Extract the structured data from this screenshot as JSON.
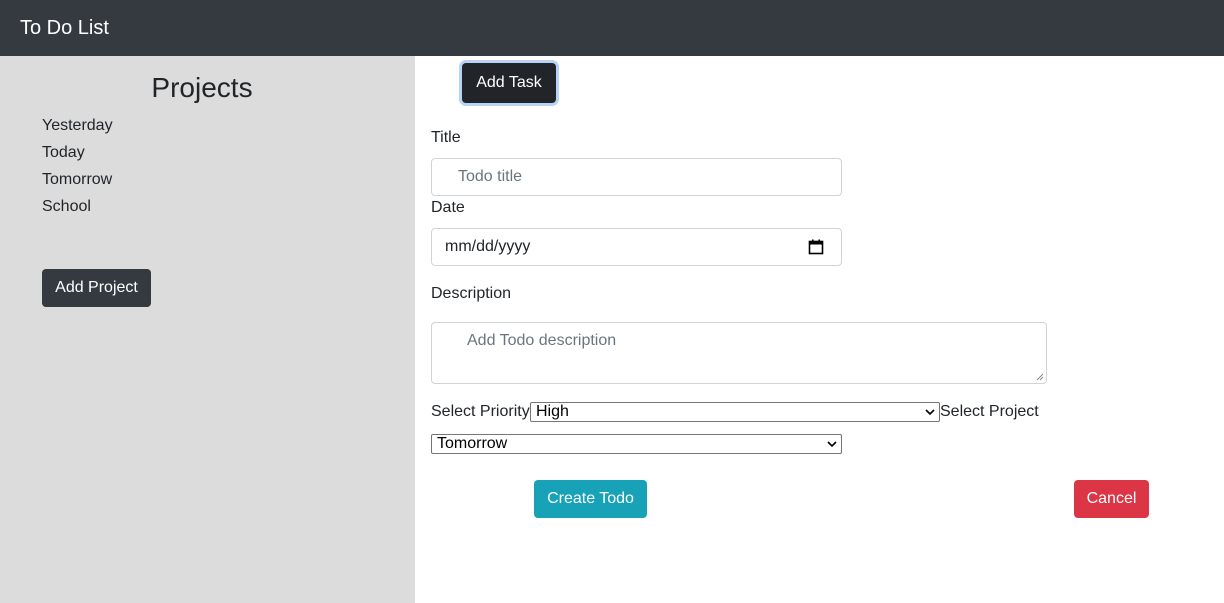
{
  "app": {
    "title": "To Do List"
  },
  "sidebar": {
    "heading": "Projects",
    "projects": [
      "Yesterday",
      "Today",
      "Tomorrow",
      "School"
    ],
    "add_project_label": "Add Project"
  },
  "main": {
    "add_task_label": "Add Task",
    "form": {
      "title_label": "Title",
      "title_placeholder": "Todo title",
      "date_label": "Date",
      "date_value": "mm/dd/yyyy",
      "description_label": "Description",
      "description_placeholder": "Add Todo description",
      "priority_label": "Select Priority",
      "priority_selected": "High",
      "project_label": "Select Project",
      "project_selected": "Tomorrow",
      "create_label": "Create Todo",
      "cancel_label": "Cancel"
    }
  },
  "colors": {
    "navbar": "#343a40",
    "sidebar": "#dcdcdc",
    "create_button": "#17a2b8",
    "cancel_button": "#dc3545",
    "add_task_button": "#212529"
  },
  "icons": {
    "date": "calendar-icon",
    "select": "chevron-down-icon",
    "textarea": "resize-handle-icon"
  }
}
